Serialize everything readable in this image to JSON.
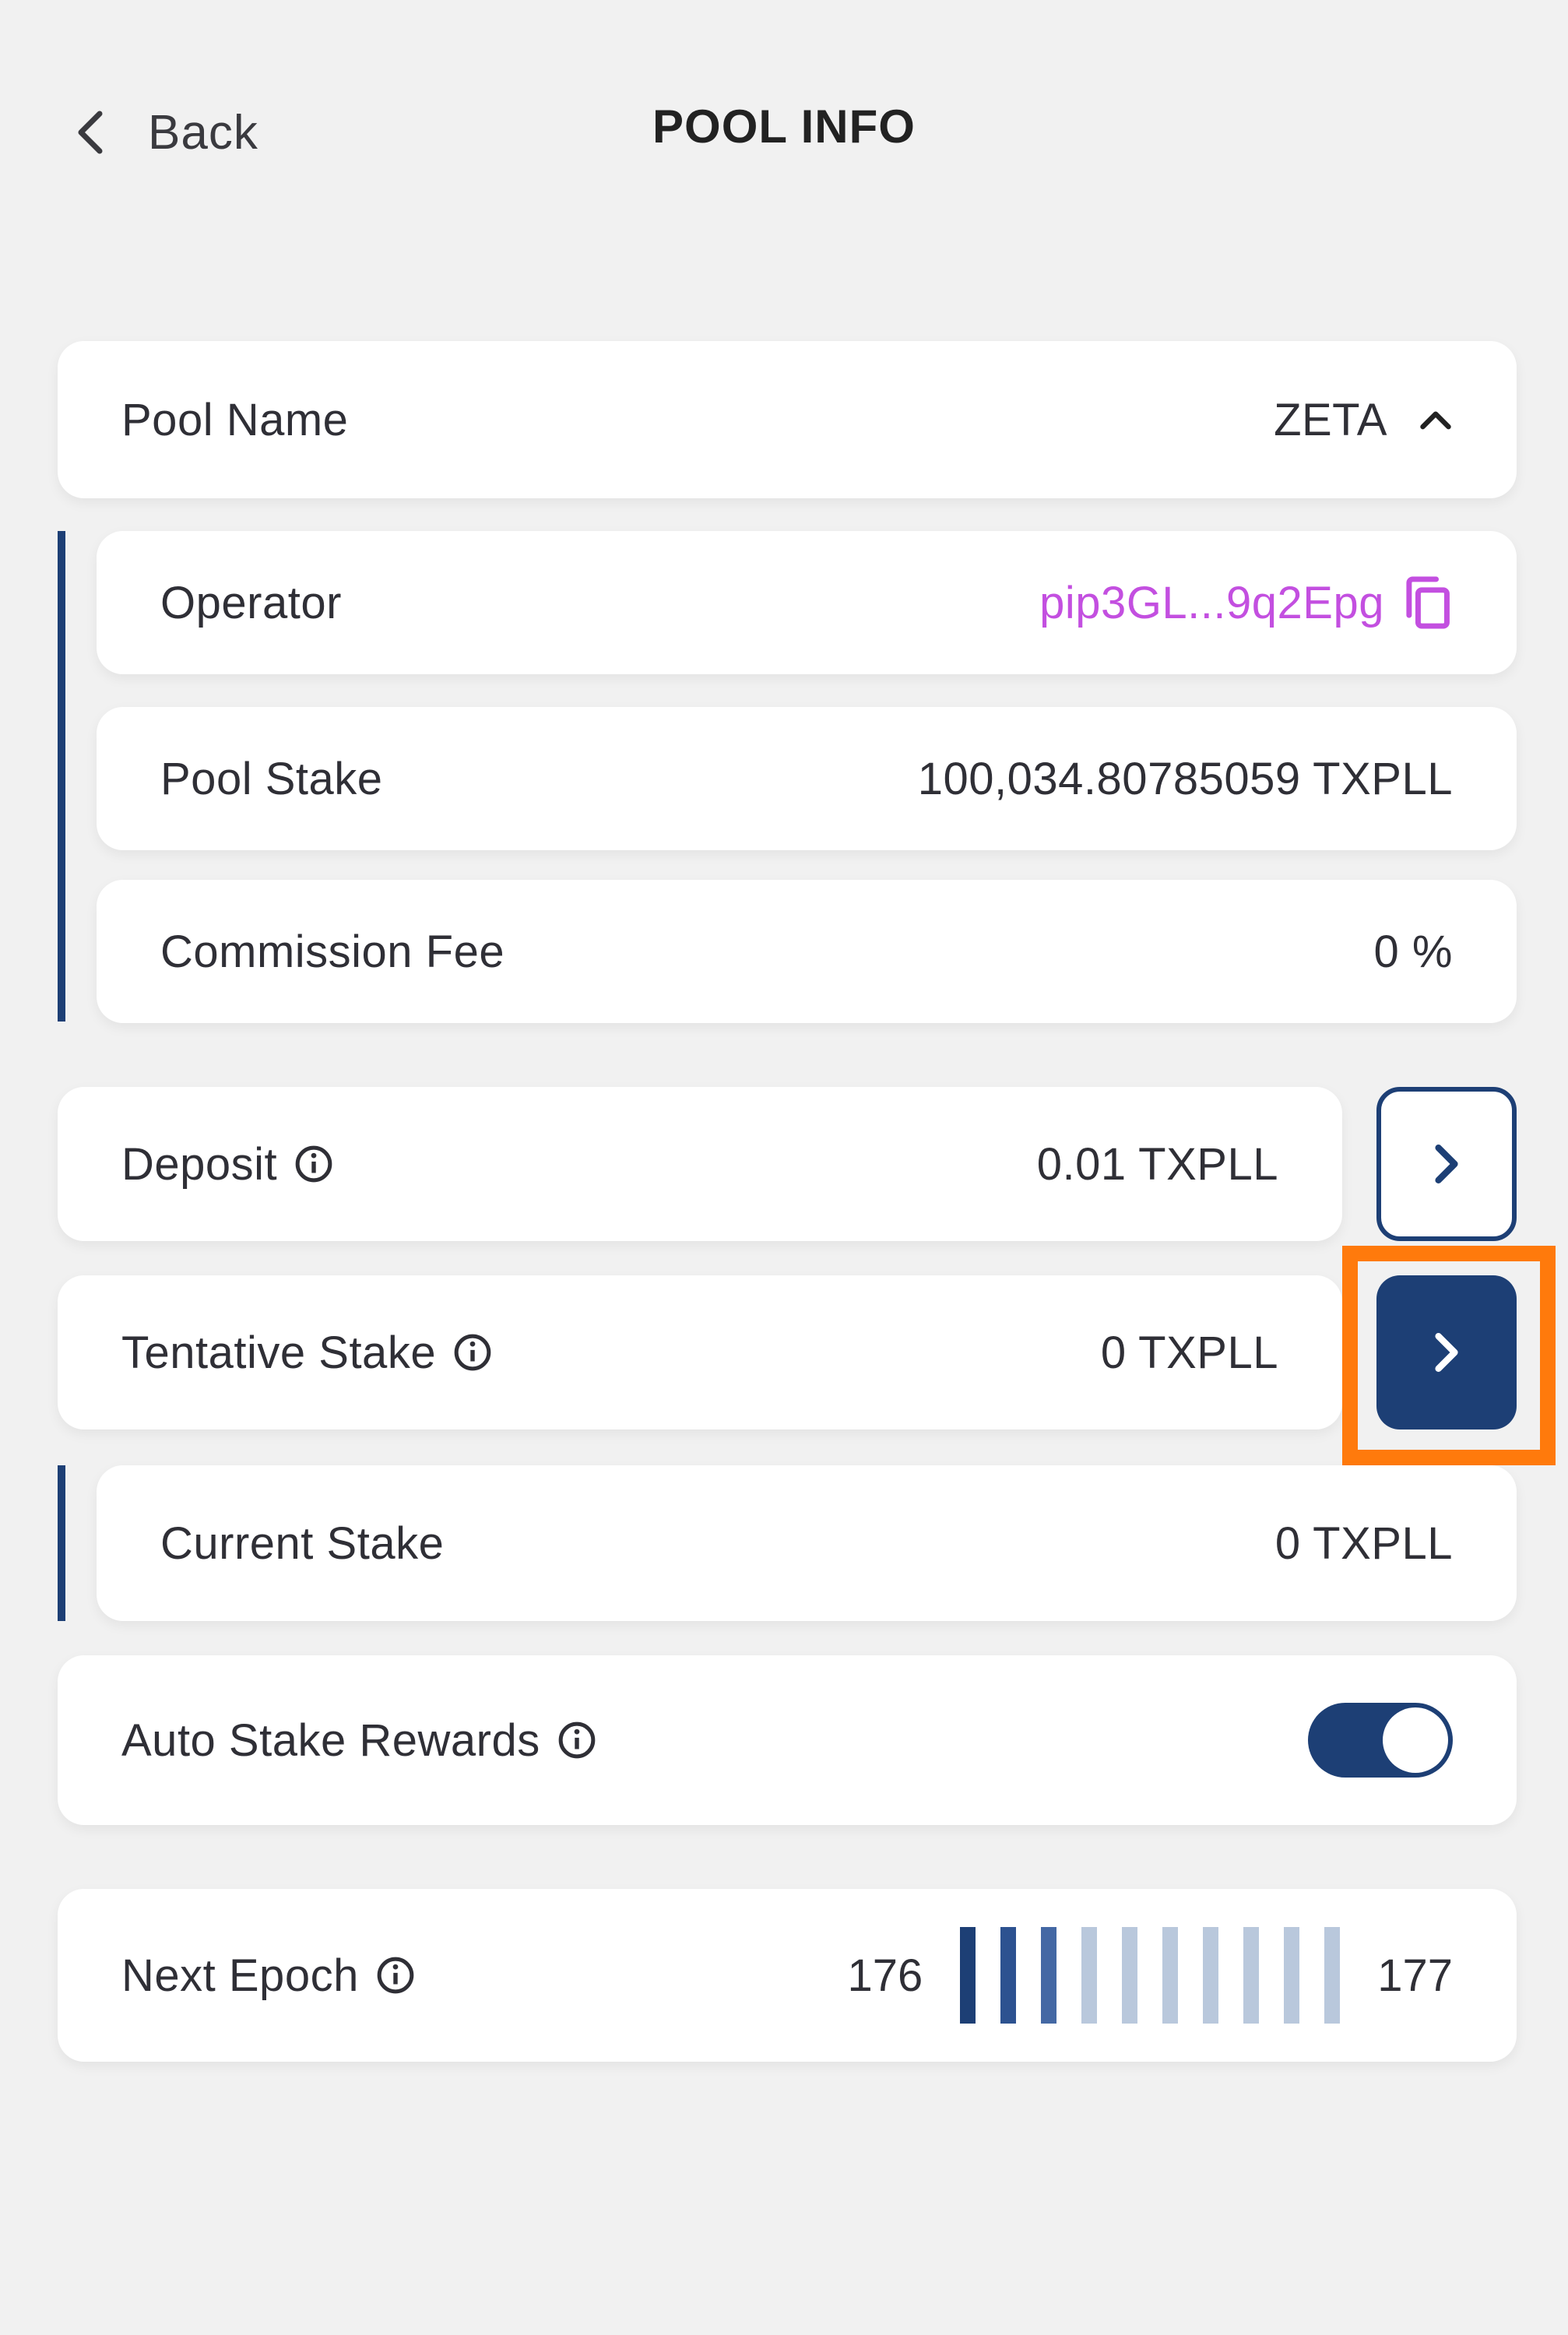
{
  "header": {
    "back_label": "Back",
    "title": "POOL INFO"
  },
  "pool_name": {
    "label": "Pool Name",
    "value": "ZETA"
  },
  "operator": {
    "label": "Operator",
    "value": "pip3GL...9q2Epg"
  },
  "pool_stake": {
    "label": "Pool Stake",
    "value": "100,034.80785059 TXPLL"
  },
  "commission_fee": {
    "label": "Commission Fee",
    "value": "0 %"
  },
  "deposit": {
    "label": "Deposit",
    "value": "0.01 TXPLL"
  },
  "tentative_stake": {
    "label": "Tentative Stake",
    "value": "0 TXPLL"
  },
  "current_stake": {
    "label": "Current Stake",
    "value": "0 TXPLL"
  },
  "auto_stake": {
    "label": "Auto Stake Rewards",
    "enabled": true
  },
  "next_epoch": {
    "label": "Next Epoch",
    "from": "176",
    "to": "177",
    "progress_segments_filled": 3,
    "progress_segments_total": 10
  },
  "colors": {
    "accent": "#1d3f75",
    "highlight": "#ff7a0c",
    "operator_link": "#c34fe0",
    "background": "#f1f1f1"
  },
  "icons": [
    "chevron-left-icon",
    "chevron-up-icon",
    "copy-icon",
    "info-icon",
    "chevron-right-icon"
  ]
}
